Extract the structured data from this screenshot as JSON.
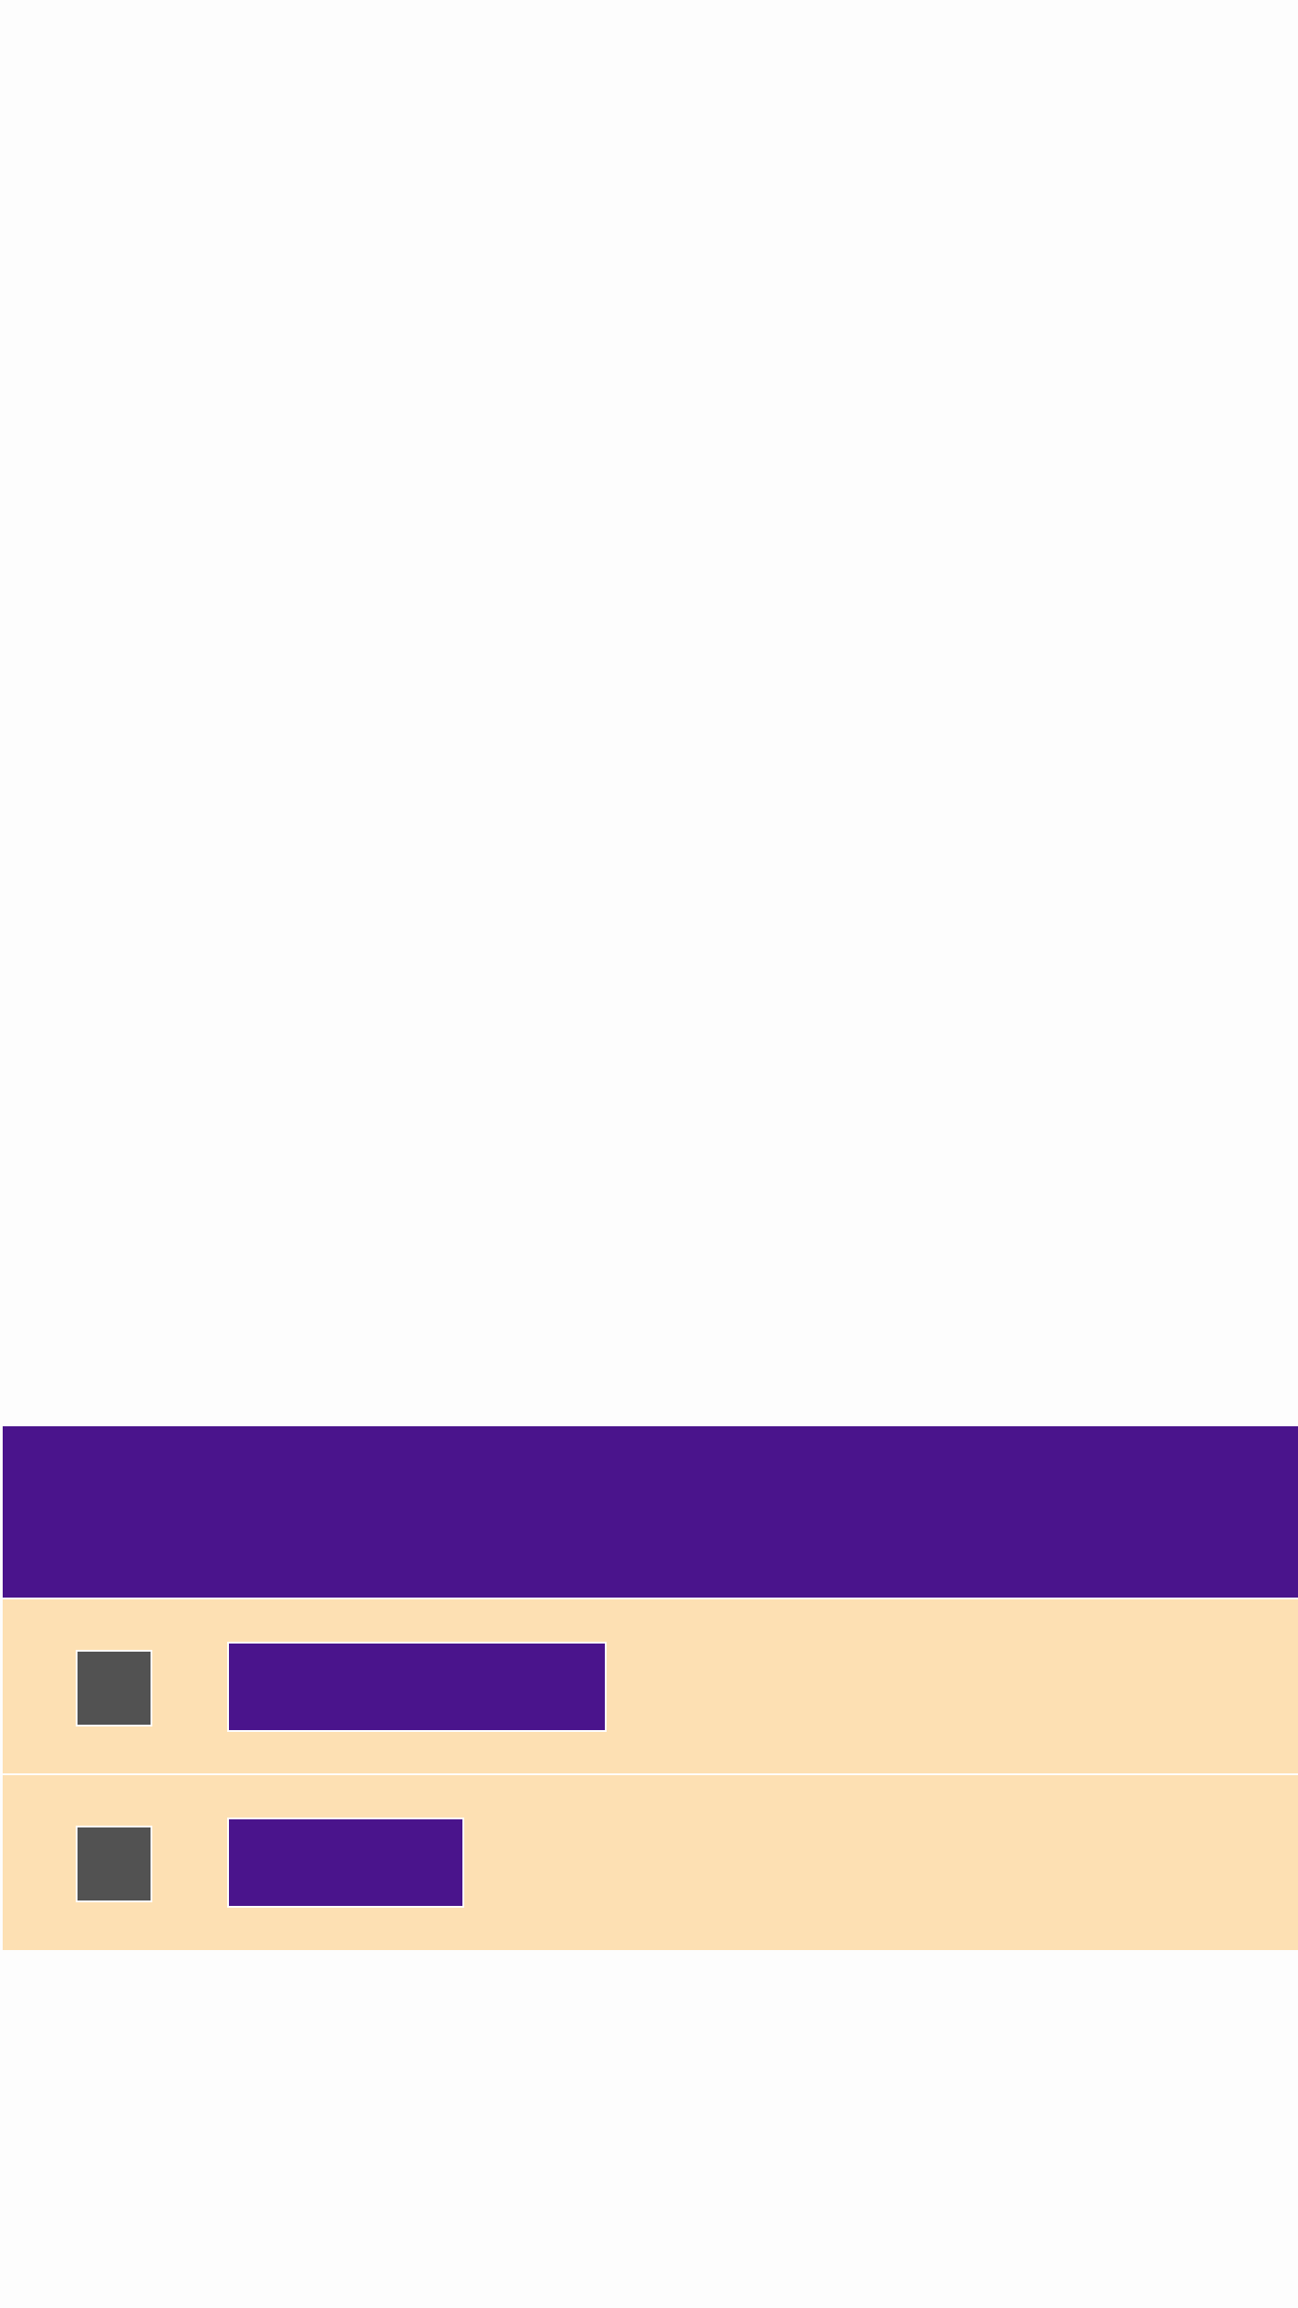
{
  "colors": {
    "background": "#fdfdfd",
    "accent": "#4a148c",
    "row_background": "#fde0b3",
    "icon_fill": "#525252",
    "divider": "#ffffff"
  },
  "panel": {
    "header": {
      "title": ""
    },
    "items": [
      {
        "icon": "item-icon",
        "label": ""
      },
      {
        "icon": "item-icon",
        "label": ""
      }
    ]
  }
}
